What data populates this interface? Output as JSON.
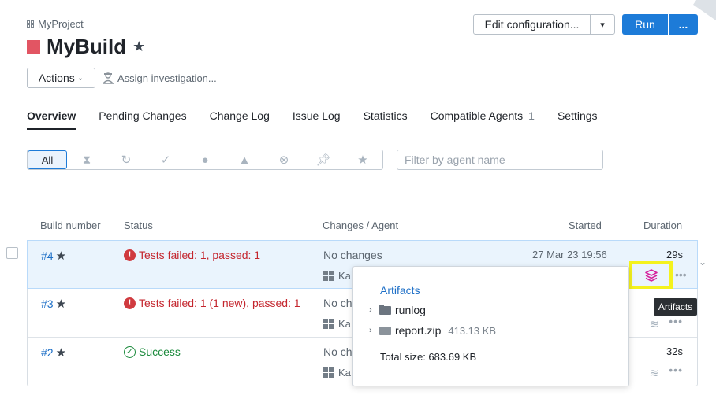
{
  "header": {
    "project": "MyProject",
    "build_title": "MyBuild",
    "edit_configuration": "Edit configuration...",
    "run": "Run",
    "run_more": "...",
    "actions": "Actions",
    "assign_investigation": "Assign investigation..."
  },
  "tabs": [
    {
      "label": "Overview"
    },
    {
      "label": "Pending Changes"
    },
    {
      "label": "Change Log"
    },
    {
      "label": "Issue Log"
    },
    {
      "label": "Statistics"
    },
    {
      "label": "Compatible Agents",
      "count": "1"
    },
    {
      "label": "Settings"
    }
  ],
  "filter": {
    "all": "All",
    "placeholder": "Filter by agent name",
    "icons": [
      "hourglass-icon",
      "spinner-icon",
      "check-circle-icon",
      "exclamation-circle-icon",
      "warning-icon",
      "cancel-circle-icon",
      "pin-icon",
      "star-icon"
    ]
  },
  "table": {
    "columns": {
      "build_number": "Build number",
      "status": "Status",
      "changes_agent": "Changes / Agent",
      "started": "Started",
      "duration": "Duration"
    },
    "rows": [
      {
        "number": "#4",
        "status": "Tests failed: 1, passed: 1",
        "status_type": "failed",
        "changes": "No changes",
        "agent": "Ka",
        "started": "27 Mar 23 19:56",
        "duration": "29s"
      },
      {
        "number": "#3",
        "status": "Tests failed: 1 (1 new), passed: 1",
        "status_type": "failed",
        "changes": "No ch",
        "agent": "Ka",
        "started": "",
        "duration": ""
      },
      {
        "number": "#2",
        "status": "Success",
        "status_type": "success",
        "changes": "No ch",
        "agent": "Ka",
        "started": "",
        "duration": "32s"
      }
    ]
  },
  "artifacts_popup": {
    "title": "Artifacts",
    "items": [
      {
        "name": "runlog",
        "type": "folder",
        "size": ""
      },
      {
        "name": "report.zip",
        "type": "zip",
        "size": "413.13 KB"
      }
    ],
    "total": "Total size: 683.69 KB"
  },
  "tooltip": "Artifacts",
  "colors": {
    "accent": "#1d7bd8",
    "failed": "#c4262e",
    "success": "#1b8a3c",
    "build_status": "#e25563",
    "highlight": "#f4f21e",
    "artifacts_icon": "#d6239e"
  }
}
